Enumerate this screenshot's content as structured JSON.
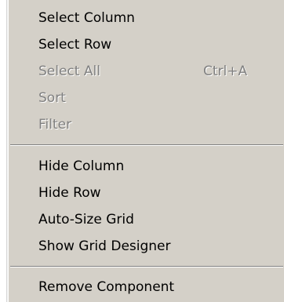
{
  "menu": {
    "groups": [
      {
        "items": [
          {
            "label": "Select Column",
            "enabled": true
          },
          {
            "label": "Select Row",
            "enabled": true
          },
          {
            "label": "Select All",
            "shortcut": "Ctrl+A",
            "enabled": false
          },
          {
            "label": "Sort",
            "enabled": false
          },
          {
            "label": "Filter",
            "enabled": false
          }
        ]
      },
      {
        "items": [
          {
            "label": "Hide Column",
            "enabled": true
          },
          {
            "label": "Hide Row",
            "enabled": true
          },
          {
            "label": "Auto-Size Grid",
            "enabled": true
          },
          {
            "label": "Show Grid Designer",
            "enabled": true
          }
        ]
      },
      {
        "items": [
          {
            "label": "Remove Component",
            "enabled": true
          }
        ]
      }
    ]
  },
  "colors": {
    "menu_background": "#d4d0c8",
    "enabled_text": "#000000",
    "disabled_text": "#808080",
    "separator_dark": "#808080",
    "separator_light": "#ffffff"
  }
}
